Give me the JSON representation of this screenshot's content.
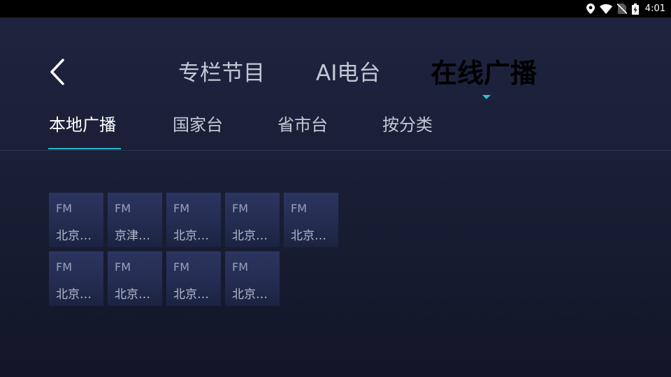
{
  "status_bar": {
    "time": "4:01",
    "icons": [
      "location-icon",
      "wifi-icon",
      "no-sim-icon",
      "battery-charging-icon"
    ]
  },
  "top_tabs": [
    {
      "label": "专栏节目",
      "active": false
    },
    {
      "label": "AI电台",
      "active": false
    },
    {
      "label": "在线广播",
      "active": true
    }
  ],
  "sub_tabs": [
    {
      "label": "本地广播",
      "active": true
    },
    {
      "label": "国家台",
      "active": false
    },
    {
      "label": "省市台",
      "active": false
    },
    {
      "label": "按分类",
      "active": false
    }
  ],
  "stations": [
    {
      "band": "FM",
      "name": "北京…"
    },
    {
      "band": "FM",
      "name": "京津…"
    },
    {
      "band": "FM",
      "name": "北京…"
    },
    {
      "band": "FM",
      "name": "北京…"
    },
    {
      "band": "FM",
      "name": "北京…"
    },
    {
      "band": "FM",
      "name": "北京…"
    },
    {
      "band": "FM",
      "name": "北京…"
    },
    {
      "band": "FM",
      "name": "北京…"
    },
    {
      "band": "FM",
      "name": "北京…"
    }
  ],
  "colors": {
    "accent": "#2fb7cf",
    "background_top": "#1f2540",
    "background_bottom": "#121628",
    "card": "#2a3560"
  }
}
